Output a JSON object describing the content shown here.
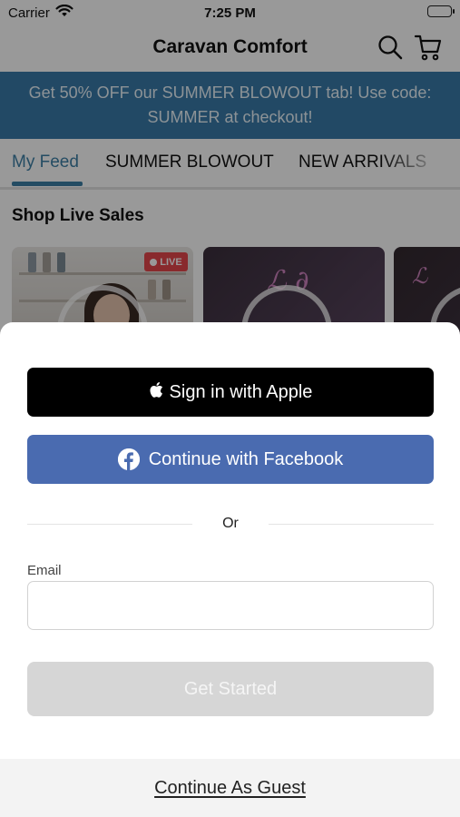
{
  "status_bar": {
    "carrier": "Carrier",
    "time": "7:25 PM"
  },
  "header": {
    "title": "Caravan Comfort",
    "icons": [
      "search-icon",
      "cart-icon"
    ]
  },
  "promo": {
    "text": "Get 50% OFF our SUMMER BLOWOUT tab! Use code: SUMMER at checkout!",
    "background": "#3a7ba8"
  },
  "tabs": [
    {
      "label": "My Feed",
      "active": true
    },
    {
      "label": "SUMMER BLOWOUT",
      "active": false
    },
    {
      "label": "NEW ARRIVALS",
      "active": false
    }
  ],
  "live_sales": {
    "title": "Shop Live Sales",
    "badge": "LIVE"
  },
  "sheet": {
    "apple_label": "Sign in with Apple",
    "facebook_label": "Continue with Facebook",
    "or_text": "Or",
    "email_label": "Email",
    "email_value": "",
    "email_placeholder": "",
    "get_started_label": "Get Started",
    "guest_label": "Continue As Guest"
  },
  "colors": {
    "accent": "#3d7fa6",
    "facebook": "#4a6bb0",
    "live_badge": "#e4474c",
    "disabled_button": "#d6d6d6"
  }
}
